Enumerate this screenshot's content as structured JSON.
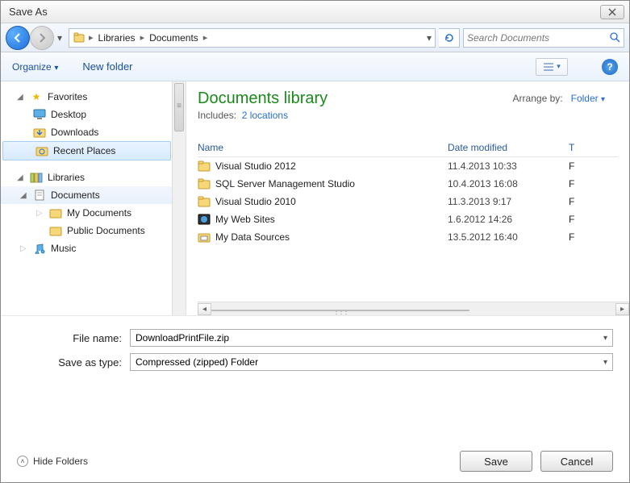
{
  "window": {
    "title": "Save As"
  },
  "nav": {
    "crumbs": [
      "Libraries",
      "Documents"
    ],
    "search_placeholder": "Search Documents"
  },
  "toolbar": {
    "organize": "Organize",
    "newfolder": "New folder"
  },
  "tree": {
    "favorites": {
      "label": "Favorites",
      "items": [
        "Desktop",
        "Downloads",
        "Recent Places"
      ],
      "selected": 2
    },
    "libraries": {
      "label": "Libraries",
      "documents": {
        "label": "Documents",
        "children": [
          "My Documents",
          "Public Documents"
        ]
      },
      "music": {
        "label": "Music"
      }
    }
  },
  "library": {
    "title": "Documents library",
    "includes_label": "Includes:",
    "includes_link": "2 locations",
    "arrange_label": "Arrange by:",
    "arrange_value": "Folder"
  },
  "columns": {
    "name": "Name",
    "date": "Date modified",
    "type": "T"
  },
  "rows": [
    {
      "name": "Visual Studio 2012",
      "date": "11.4.2013 10:33",
      "t": "F",
      "icon": "folder"
    },
    {
      "name": "SQL Server Management Studio",
      "date": "10.4.2013 16:08",
      "t": "F",
      "icon": "folder"
    },
    {
      "name": "Visual Studio 2010",
      "date": "11.3.2013 9:17",
      "t": "F",
      "icon": "folder"
    },
    {
      "name": "My Web Sites",
      "date": "1.6.2012 14:26",
      "t": "F",
      "icon": "web"
    },
    {
      "name": "My Data Sources",
      "date": "13.5.2012 16:40",
      "t": "F",
      "icon": "data"
    }
  ],
  "form": {
    "filename_label": "File name:",
    "filename_value": "DownloadPrintFile.zip",
    "type_label": "Save as type:",
    "type_value": "Compressed (zipped) Folder"
  },
  "footer": {
    "hide": "Hide Folders",
    "save": "Save",
    "cancel": "Cancel"
  }
}
